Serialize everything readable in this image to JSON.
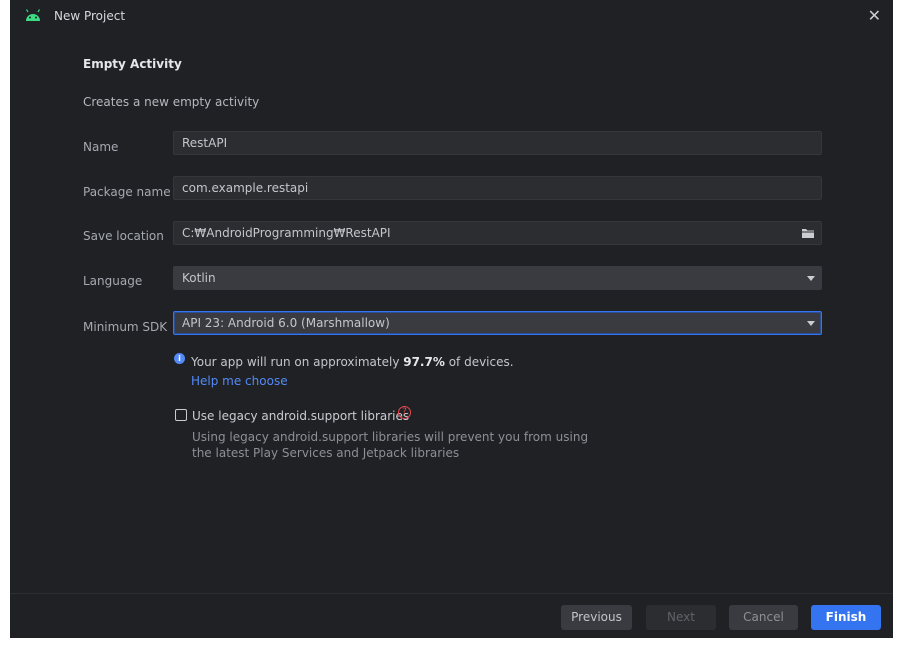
{
  "window": {
    "title": "New Project",
    "close_glyph": "✕"
  },
  "template": {
    "heading": "Empty Activity",
    "description": "Creates a new empty activity"
  },
  "form": {
    "name": {
      "label": "Name",
      "value": "RestAPI"
    },
    "package": {
      "label": "Package name",
      "value": "com.example.restapi"
    },
    "save_location": {
      "label": "Save location",
      "value": "C:₩AndroidProgramming₩RestAPI",
      "icon": "folder-icon"
    },
    "language": {
      "label": "Language",
      "value": "Kotlin"
    },
    "min_sdk": {
      "label": "Minimum SDK",
      "value": "API 23: Android 6.0 (Marshmallow)"
    }
  },
  "info": {
    "prefix": "Your app will run on approximately ",
    "percent": "97.7%",
    "suffix": " of devices.",
    "help_link": "Help me choose"
  },
  "legacy": {
    "checkbox_label": "Use legacy android.support libraries",
    "checked": false,
    "warning_line1": "Using legacy android.support libraries will prevent you from using",
    "warning_line2": "the latest Play Services and Jetpack libraries"
  },
  "buttons": {
    "previous": "Previous",
    "next": "Next",
    "cancel": "Cancel",
    "finish": "Finish"
  },
  "colors": {
    "accent": "#3574f0",
    "background": "#1f2124",
    "link": "#548af7",
    "help_icon": "#e5484d"
  }
}
